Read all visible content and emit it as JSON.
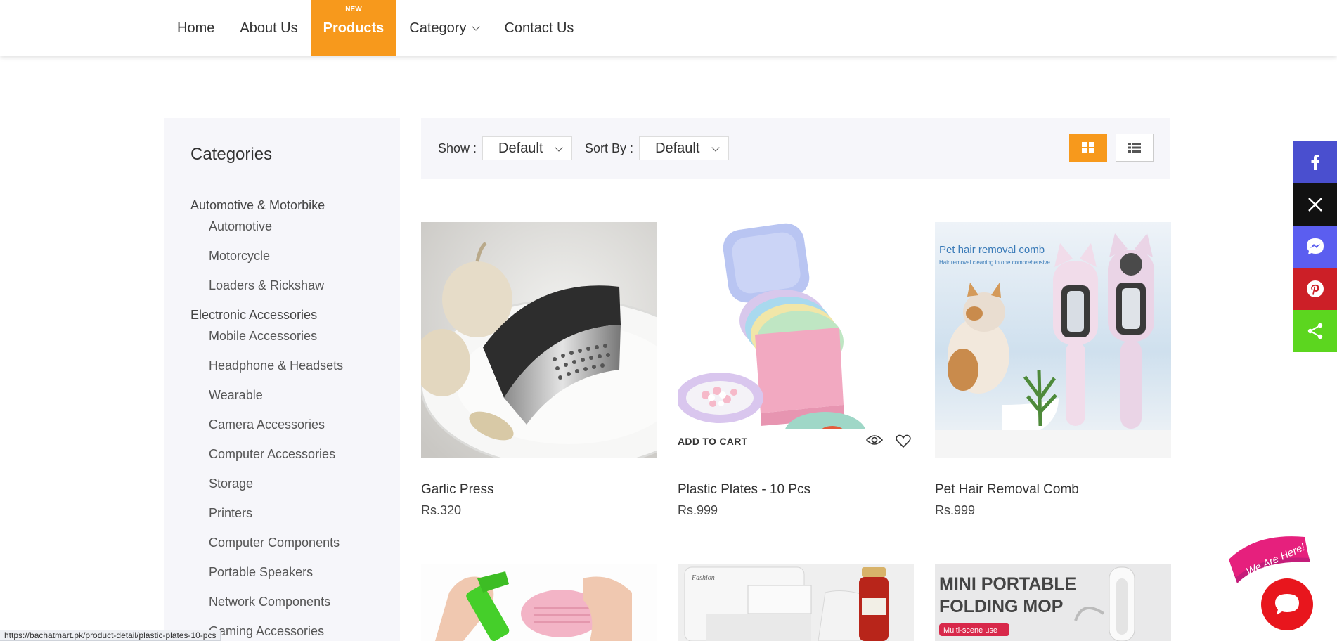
{
  "nav": {
    "items": [
      {
        "label": "Home"
      },
      {
        "label": "About Us"
      },
      {
        "label": "Products",
        "badge": "NEW"
      },
      {
        "label": "Category"
      },
      {
        "label": "Contact Us"
      }
    ]
  },
  "sidebar": {
    "title": "Categories",
    "groups": [
      {
        "parent": "Automotive & Motorbike",
        "children": [
          "Automotive",
          "Motorcycle",
          "Loaders & Rickshaw"
        ]
      },
      {
        "parent": "Electronic Accessories",
        "children": [
          "Mobile Accessories",
          "Headphone & Headsets",
          "Wearable",
          "Camera Accessories",
          "Computer Accessories",
          "Storage",
          "Printers",
          "Computer Components",
          "Portable Speakers",
          "Network Components",
          "Gaming Accessories"
        ]
      }
    ]
  },
  "toolbar": {
    "show_label": "Show :",
    "show_value": "Default",
    "sort_label": "Sort By :",
    "sort_value": "Default"
  },
  "products": [
    {
      "name": "Garlic Press",
      "price": "Rs.320"
    },
    {
      "name": "Plastic Plates - 10 Pcs",
      "price": "Rs.999",
      "add_to_cart": "ADD TO CART"
    },
    {
      "name": "Pet Hair Removal Comb",
      "price": "Rs.999",
      "img_title": "Pet hair removal comb",
      "img_subtitle": "Hair removal cleaning in one comprehensive"
    },
    {
      "name": "",
      "price": ""
    },
    {
      "name": "",
      "price": "",
      "img_text": "Fashion"
    },
    {
      "name": "",
      "price": "",
      "img_title_1": "MINI PORTABLE",
      "img_title_2": "FOLDING MOP",
      "img_tag": "Multi-scene use"
    }
  ],
  "chat": {
    "badge": "We Are Here!"
  },
  "status_url": "https://bachatmart.pk/product-detail/plastic-plates-10-pcs",
  "colors": {
    "accent": "#f7991c",
    "facebook": "#4a4fcf",
    "x": "#111111",
    "messenger": "#5b5ef0",
    "pinterest": "#cc1f27",
    "share": "#5cd61f",
    "chat": "#e8161d"
  }
}
